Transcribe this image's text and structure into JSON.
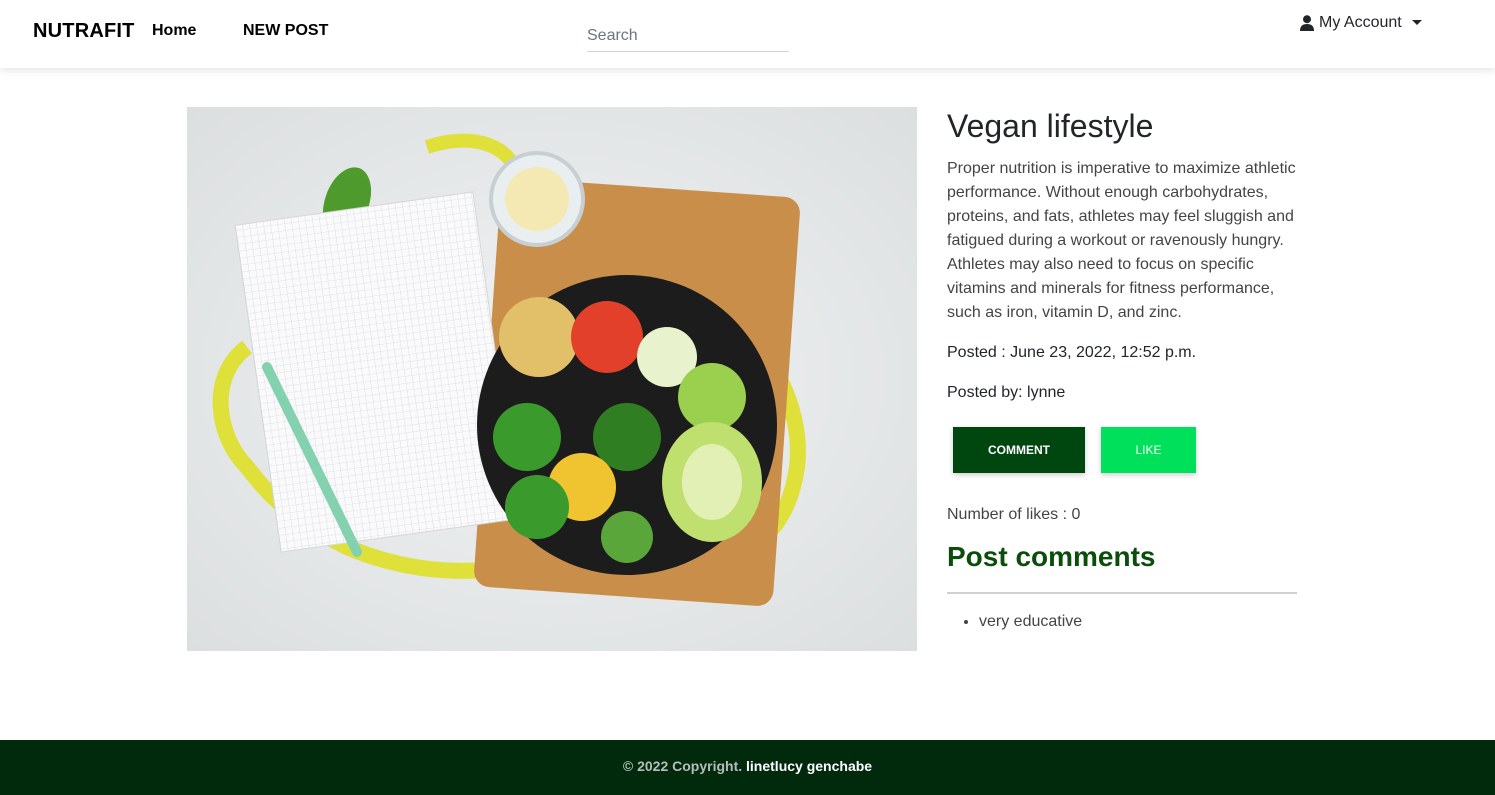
{
  "nav": {
    "brand": "NUTRAFIT",
    "home": "Home",
    "new_post": "NEW POST",
    "search_placeholder": "Search",
    "account": "My Account"
  },
  "post": {
    "title": "Vegan lifestyle",
    "body": "Proper nutrition is imperative to maximize athletic performance. Without enough carbohydrates, proteins, and fats, athletes may feel sluggish and fatigued during a workout or ravenously hungry. Athletes may also need to focus on specific vitamins and minerals for fitness performance, such as iron, vitamin D, and zinc.",
    "posted": "Posted : June 23, 2022, 12:52 p.m.",
    "posted_by": "Posted by: lynne",
    "comment_button": "COMMENT",
    "like_button": "LIKE",
    "likes": "Number of likes : 0",
    "comments_heading": "Post comments",
    "comments": [
      "very educative"
    ]
  },
  "footer": {
    "copyright": "© 2022 Copyright.",
    "author": "linetlucy genchabe"
  },
  "colors": {
    "comment_button": "#00470f",
    "like_button": "#00e05a",
    "footer_bg": "#012a0d",
    "heading_green": "#0b4d0b"
  }
}
